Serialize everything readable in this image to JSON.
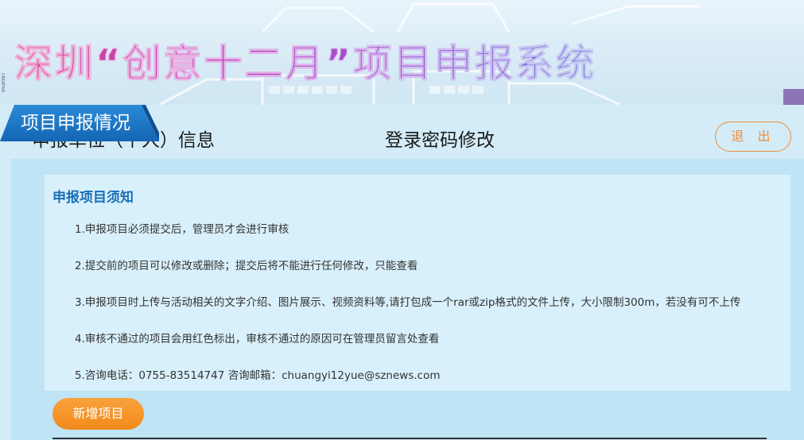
{
  "banner": {
    "title": "深圳“创意十二月”项目申报系统",
    "side_text": "CREATIVE"
  },
  "tabs": [
    {
      "label": "申报单位（个人）信息",
      "active": false
    },
    {
      "label": "项目申报情况",
      "active": true
    },
    {
      "label": "登录密码修改",
      "active": false
    }
  ],
  "logout_label": "退 出",
  "notice": {
    "title": "申报项目须知",
    "items": [
      "1.申报项目必须提交后，管理员才会进行审核",
      "2.提交前的项目可以修改或删除；提交后将不能进行任何修改，只能查看",
      "3.申报项目时上传与活动相关的文字介绍、图片展示、视频资料等,请打包成一个rar或zip格式的文件上传，大小限制300m，若没有可不上传",
      "4.审核不通过的项目会用红色标出，审核不通过的原因可在管理员留言处查看",
      "5.咨询电话：0755-83514747 咨询邮箱：chuangyi12yue@sznews.com"
    ]
  },
  "add_button_label": "新增项目",
  "colors": {
    "accent_blue": "#1a6fb5",
    "active_tab": "#1776c9",
    "orange": "#f28a1b"
  }
}
